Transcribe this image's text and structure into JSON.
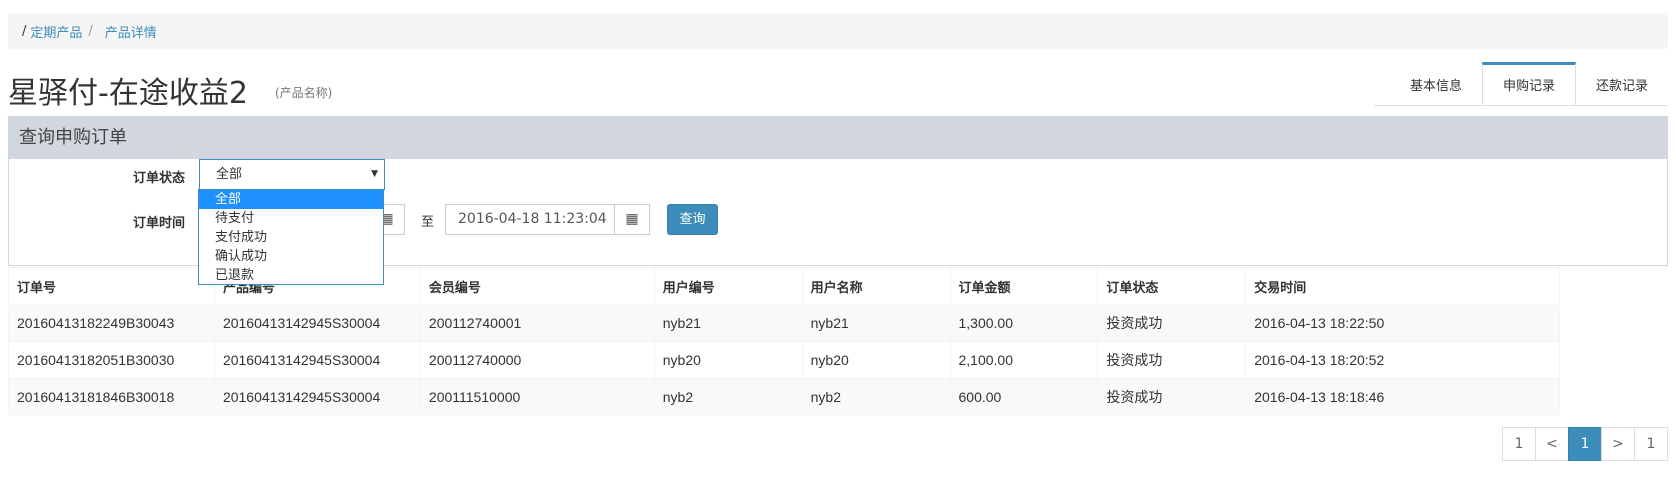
{
  "breadcrumb": {
    "root_sep": "/",
    "item1": "定期产品",
    "sep": "/",
    "item2": "产品详情"
  },
  "page": {
    "title": "星驿付-在途收益2",
    "subtitle": "(产品名称)"
  },
  "tabs": [
    {
      "label": "基本信息"
    },
    {
      "label": "申购记录"
    },
    {
      "label": "还款记录"
    }
  ],
  "search_panel": {
    "title": "查询申购订单",
    "status_label": "订单状态",
    "status_value": "全部",
    "status_options": [
      "全部",
      "待支付",
      "支付成功",
      "确认成功",
      "已退款"
    ],
    "time_label": "订单时间",
    "to_label": "至",
    "end_time": "2016-04-18 11:23:04",
    "query_button": "查询"
  },
  "table": {
    "headers": [
      "订单号",
      "产品编号",
      "会员编号",
      "用户编号",
      "用户名称",
      "订单金额",
      "订单状态",
      "交易时间"
    ],
    "rows": [
      [
        "20160413182249B30043",
        "20160413142945S30004",
        "200112740001",
        "nyb21",
        "nyb21",
        "1,300.00",
        "投资成功",
        "2016-04-13 18:22:50"
      ],
      [
        "20160413182051B30030",
        "20160413142945S30004",
        "200112740000",
        "nyb20",
        "nyb20",
        "2,100.00",
        "投资成功",
        "2016-04-13 18:20:52"
      ],
      [
        "20160413181846B30018",
        "20160413142945S30004",
        "200111510000",
        "nyb2",
        "nyb2",
        "600.00",
        "投资成功",
        "2016-04-13 18:18:46"
      ]
    ]
  },
  "pagination": {
    "first": "1",
    "prev": "<",
    "current": "1",
    "next": ">",
    "last": "1"
  },
  "icons": {
    "calendar": "calendar-icon",
    "caret": "caret-down-icon"
  },
  "colors": {
    "accent": "#3c8dbc",
    "dropdown_selected": "#1e90ff",
    "panel_header": "#d2d6de"
  }
}
